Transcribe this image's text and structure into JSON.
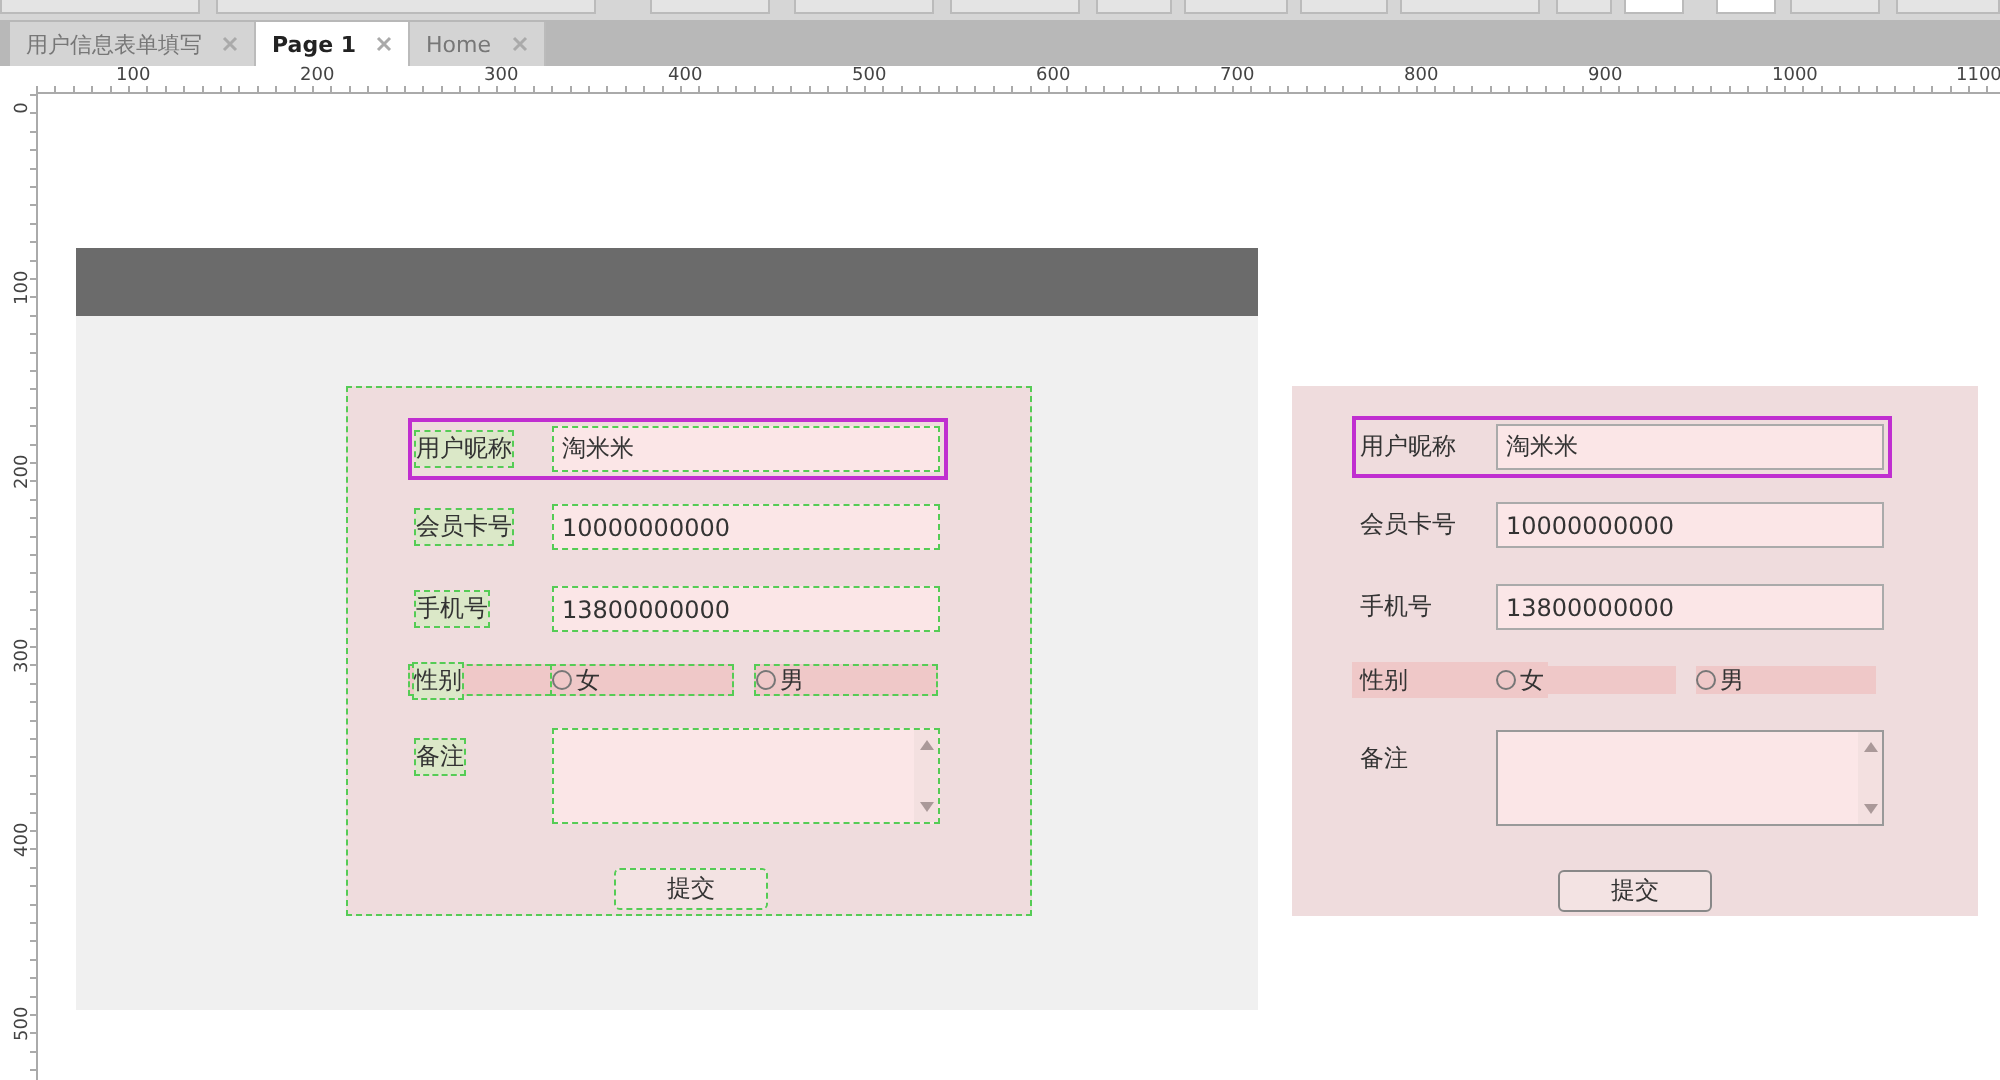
{
  "tabs": [
    {
      "label": "用户信息表单填写",
      "selected": false
    },
    {
      "label": "Page 1",
      "selected": true
    },
    {
      "label": "Home",
      "selected": false
    }
  ],
  "ruler": {
    "horizontal": [
      "100",
      "200",
      "300",
      "400",
      "500",
      "600",
      "700",
      "800",
      "900",
      "1000",
      "1100"
    ],
    "vertical": [
      "0",
      "100",
      "200",
      "300",
      "400",
      "500"
    ]
  },
  "forms": [
    {
      "selected": true,
      "rows": [
        {
          "kind": "text",
          "label": "用户昵称",
          "value": "淘米米",
          "highlighted": true
        },
        {
          "kind": "text",
          "label": "会员卡号",
          "value": "10000000000",
          "highlighted": false
        },
        {
          "kind": "text",
          "label": "手机号",
          "value": "13800000000",
          "highlighted": false
        },
        {
          "kind": "radio",
          "label": "性别",
          "options": [
            {
              "label": "女",
              "checked": false
            },
            {
              "label": "男",
              "checked": false
            }
          ],
          "highlighted": false
        },
        {
          "kind": "textarea",
          "label": "备注",
          "highlighted": false
        }
      ],
      "button": "提交"
    },
    {
      "selected": false,
      "rows": [
        {
          "kind": "text",
          "label": "用户昵称",
          "value": "淘米米",
          "highlighted": true
        },
        {
          "kind": "text",
          "label": "会员卡号",
          "value": "10000000000",
          "highlighted": false
        },
        {
          "kind": "text",
          "label": "手机号",
          "value": "13800000000",
          "highlighted": false
        },
        {
          "kind": "radio",
          "label": "性别",
          "options": [
            {
              "label": "女",
              "checked": false
            },
            {
              "label": "男",
              "checked": false
            }
          ],
          "highlighted": false
        },
        {
          "kind": "textarea",
          "label": "备注",
          "highlighted": false
        }
      ],
      "button": "提交"
    }
  ]
}
